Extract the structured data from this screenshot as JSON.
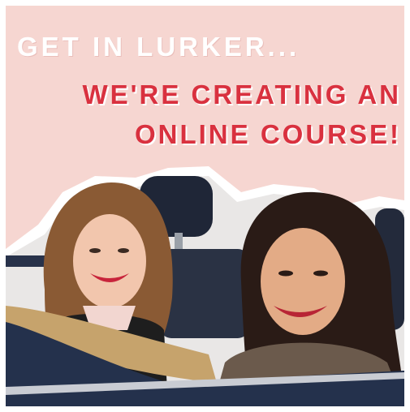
{
  "headline": {
    "line1": "GET IN LURKER...",
    "line2": "WE'RE CREATING AN",
    "line3": "ONLINE COURSE!"
  },
  "colors": {
    "background": "#f6d6d1",
    "accent": "#d9313f",
    "white": "#ffffff"
  },
  "photo": {
    "subject": "two-women-in-convertible-car"
  }
}
